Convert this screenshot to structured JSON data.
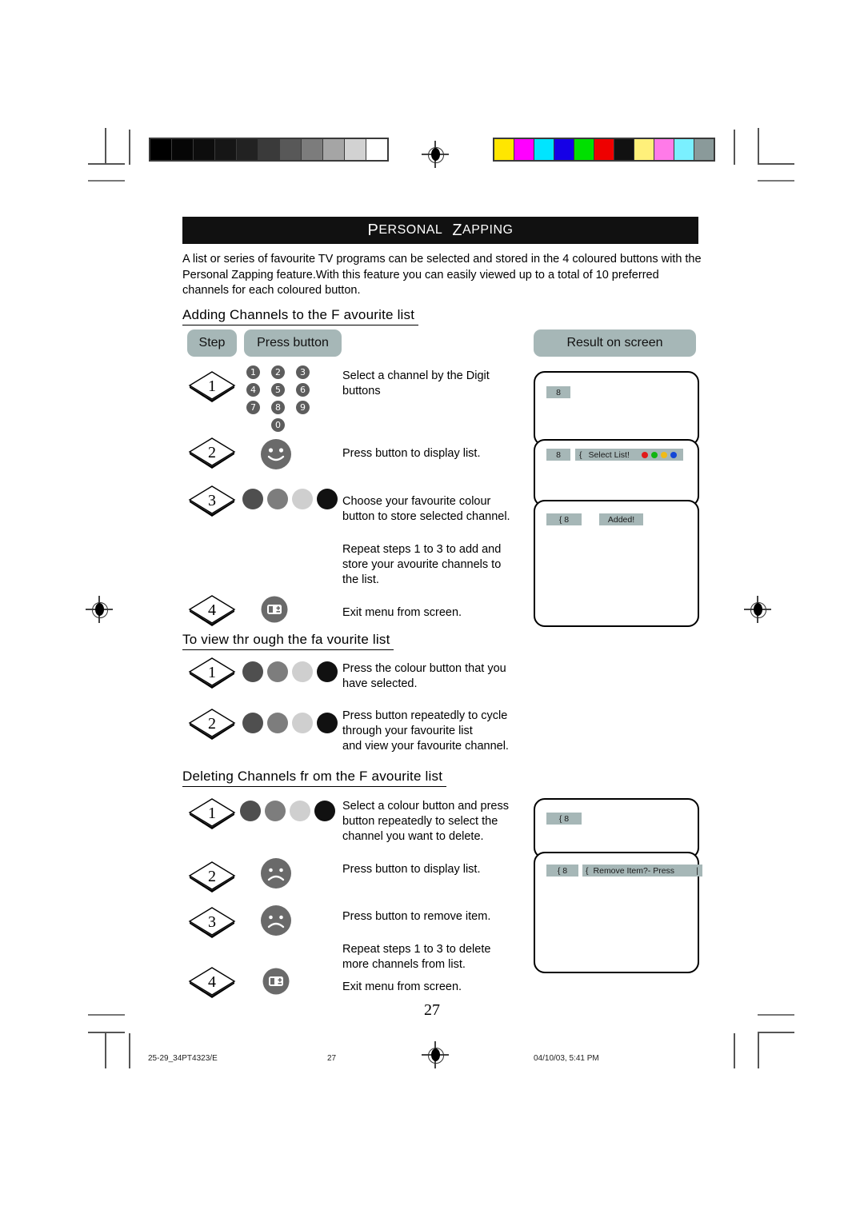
{
  "header": {
    "title_first_letter": "P",
    "title_first_rest": "ERSONAL",
    "title_second_letter": "Z",
    "title_second_rest": "APPING"
  },
  "intro": "A list or series of favourite TV programs can be selected and stored in the 4 coloured buttons with the Personal Zapping feature.With this feature you can easily viewed up to a total of 10 preferred channels for each coloured button.",
  "sections": {
    "adding": {
      "heading": "Adding Channels to the F avourite list ",
      "col_step": "Step",
      "col_press": "Press button",
      "col_result": "Result on screen",
      "steps": [
        {
          "num": "1",
          "desc": "Select a channel by the Digit\nbuttons"
        },
        {
          "num": "2",
          "desc": "Press button to display list."
        },
        {
          "num": "3",
          "desc": "Choose your favourite colour\nbutton to store selected channel."
        },
        {
          "num": "4",
          "desc": "Exit menu from screen."
        }
      ],
      "note": "Repeat steps 1 to 3 to add and\nstore your avourite channels to\nthe list.",
      "digit_keys": [
        "1",
        "2",
        "3",
        "4",
        "5",
        "6",
        "7",
        "8",
        "9",
        "0"
      ],
      "screens": {
        "screen1_channel": "8",
        "screen2_channel": "8",
        "screen2_brace": "{",
        "screen2_label": "Select List!",
        "screen3_channel": "{    8",
        "screen3_label": "Added!"
      }
    },
    "viewing": {
      "heading": "To view thr ough the fa vourite list ",
      "steps": [
        {
          "num": "1",
          "desc": "Press the colour button that you\nhave selected."
        },
        {
          "num": "2",
          "desc": "Press button repeatedly to cycle\nthrough your favourite list\nand view your favourite channel."
        }
      ]
    },
    "deleting": {
      "heading": "Deleting Channels fr om the F avourite list ",
      "steps": [
        {
          "num": "1",
          "desc": "Select a colour button and press\nbutton repeatedly to select the\nchannel you want to delete."
        },
        {
          "num": "2",
          "desc": "Press button to display list."
        },
        {
          "num": "3",
          "desc": "Press button to remove item."
        },
        {
          "num": "4",
          "desc": "Exit menu from screen."
        }
      ],
      "note": "Repeat steps 1 to 3 to delete\nmore channels from list.",
      "screens": {
        "screen1_channel": "{    8",
        "screen2_channel": "{   8",
        "screen2_brace": "{",
        "screen2_label": "Remove Item?- Press",
        "screen2_cursor": "|"
      }
    }
  },
  "page_number": "27",
  "footer": {
    "file": "25-29_34PT4323/E",
    "page": "27",
    "timestamp": "04/10/03, 5:41 PM"
  },
  "colors": {
    "pill_bg": "#a6b7b7",
    "osd_bg": "#a6b7b7",
    "title_bg": "#111111",
    "dot_red": "#e01b1b",
    "dot_green": "#12b512",
    "dot_yellow": "#f0bb17",
    "dot_blue": "#1447d6",
    "colour_button_1": "#4f4f4f",
    "colour_button_2": "#7d7d7d",
    "colour_button_3": "#cfcfcf",
    "colour_button_4": "#111111",
    "icon_circle": "#666666"
  },
  "calibration": {
    "grayscale": [
      "#000000",
      "#060606",
      "#0d0d0d",
      "#161616",
      "#222222",
      "#3a3a3a",
      "#585858",
      "#7c7c7c",
      "#a5a5a5",
      "#d2d2d2",
      "#ffffff"
    ],
    "colour": [
      "#ffe600",
      "#ff00ff",
      "#00e5ff",
      "#1500e6",
      "#00e000",
      "#ee0000",
      "#111111",
      "#fff07a",
      "#ff7ae8",
      "#7af0ff",
      "#8a9a9a"
    ]
  },
  "icons": {
    "smile": "smiley-face-icon",
    "frown": "sad-face-icon",
    "exit": "exit-menu-icon",
    "digit_pad": "digit-buttons-icon"
  }
}
